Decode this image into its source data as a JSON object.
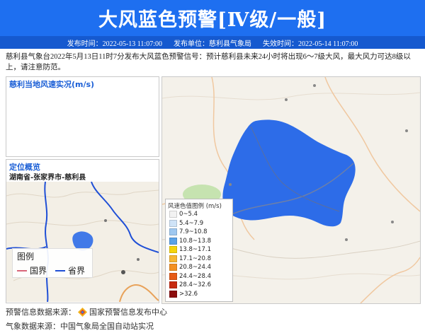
{
  "header": {
    "title": "大风蓝色预警[Ⅳ级/一般]",
    "publish_time": "发布时间：2022-05-13 11:07:00",
    "publisher": "发布单位：慈利县气象局",
    "expire_time": "失效时间：2022-05-14 11:07:00"
  },
  "description": "慈利县气象台2022年5月13日11时7分发布大风蓝色预警信号：预计慈利县未来24小时将出现6～7级大风，最大风力可达8级以上，请注意防范。",
  "wind_panel": {
    "title": "慈利当地风速实况(m/s)"
  },
  "location_panel": {
    "title": "定位概览",
    "subtitle": "湖南省-张家界市-慈利县",
    "legend_title": "图例",
    "legend_items": [
      {
        "label": "国界",
        "color": "#d9667a"
      },
      {
        "label": "省界",
        "color": "#1f4fd6"
      }
    ]
  },
  "map": {
    "legend_title": "风速色值图例 (m/s)",
    "warning_color": "#2d6ce8",
    "legend_items": [
      {
        "label": "0~5.4",
        "color": "#f2f2f2"
      },
      {
        "label": "5.4~7.9",
        "color": "#cfe3f7"
      },
      {
        "label": "7.9~10.8",
        "color": "#9fc8f0"
      },
      {
        "label": "10.8~13.8",
        "color": "#5aa2e8"
      },
      {
        "label": "13.8~17.1",
        "color": "#f5d40c"
      },
      {
        "label": "17.1~20.8",
        "color": "#f7b733"
      },
      {
        "label": "20.8~24.4",
        "color": "#f39021"
      },
      {
        "label": "24.4~28.4",
        "color": "#e65a16"
      },
      {
        "label": "28.4~32.6",
        "color": "#c72a10"
      },
      {
        "label": ">32.6",
        "color": "#8c0d0d"
      }
    ]
  },
  "footer": {
    "warning_source": "预警信息数据来源：",
    "warning_source_name": "国家预警信息发布中心",
    "weather_source": "气象数据来源：中国气象局全国自动站实况"
  }
}
